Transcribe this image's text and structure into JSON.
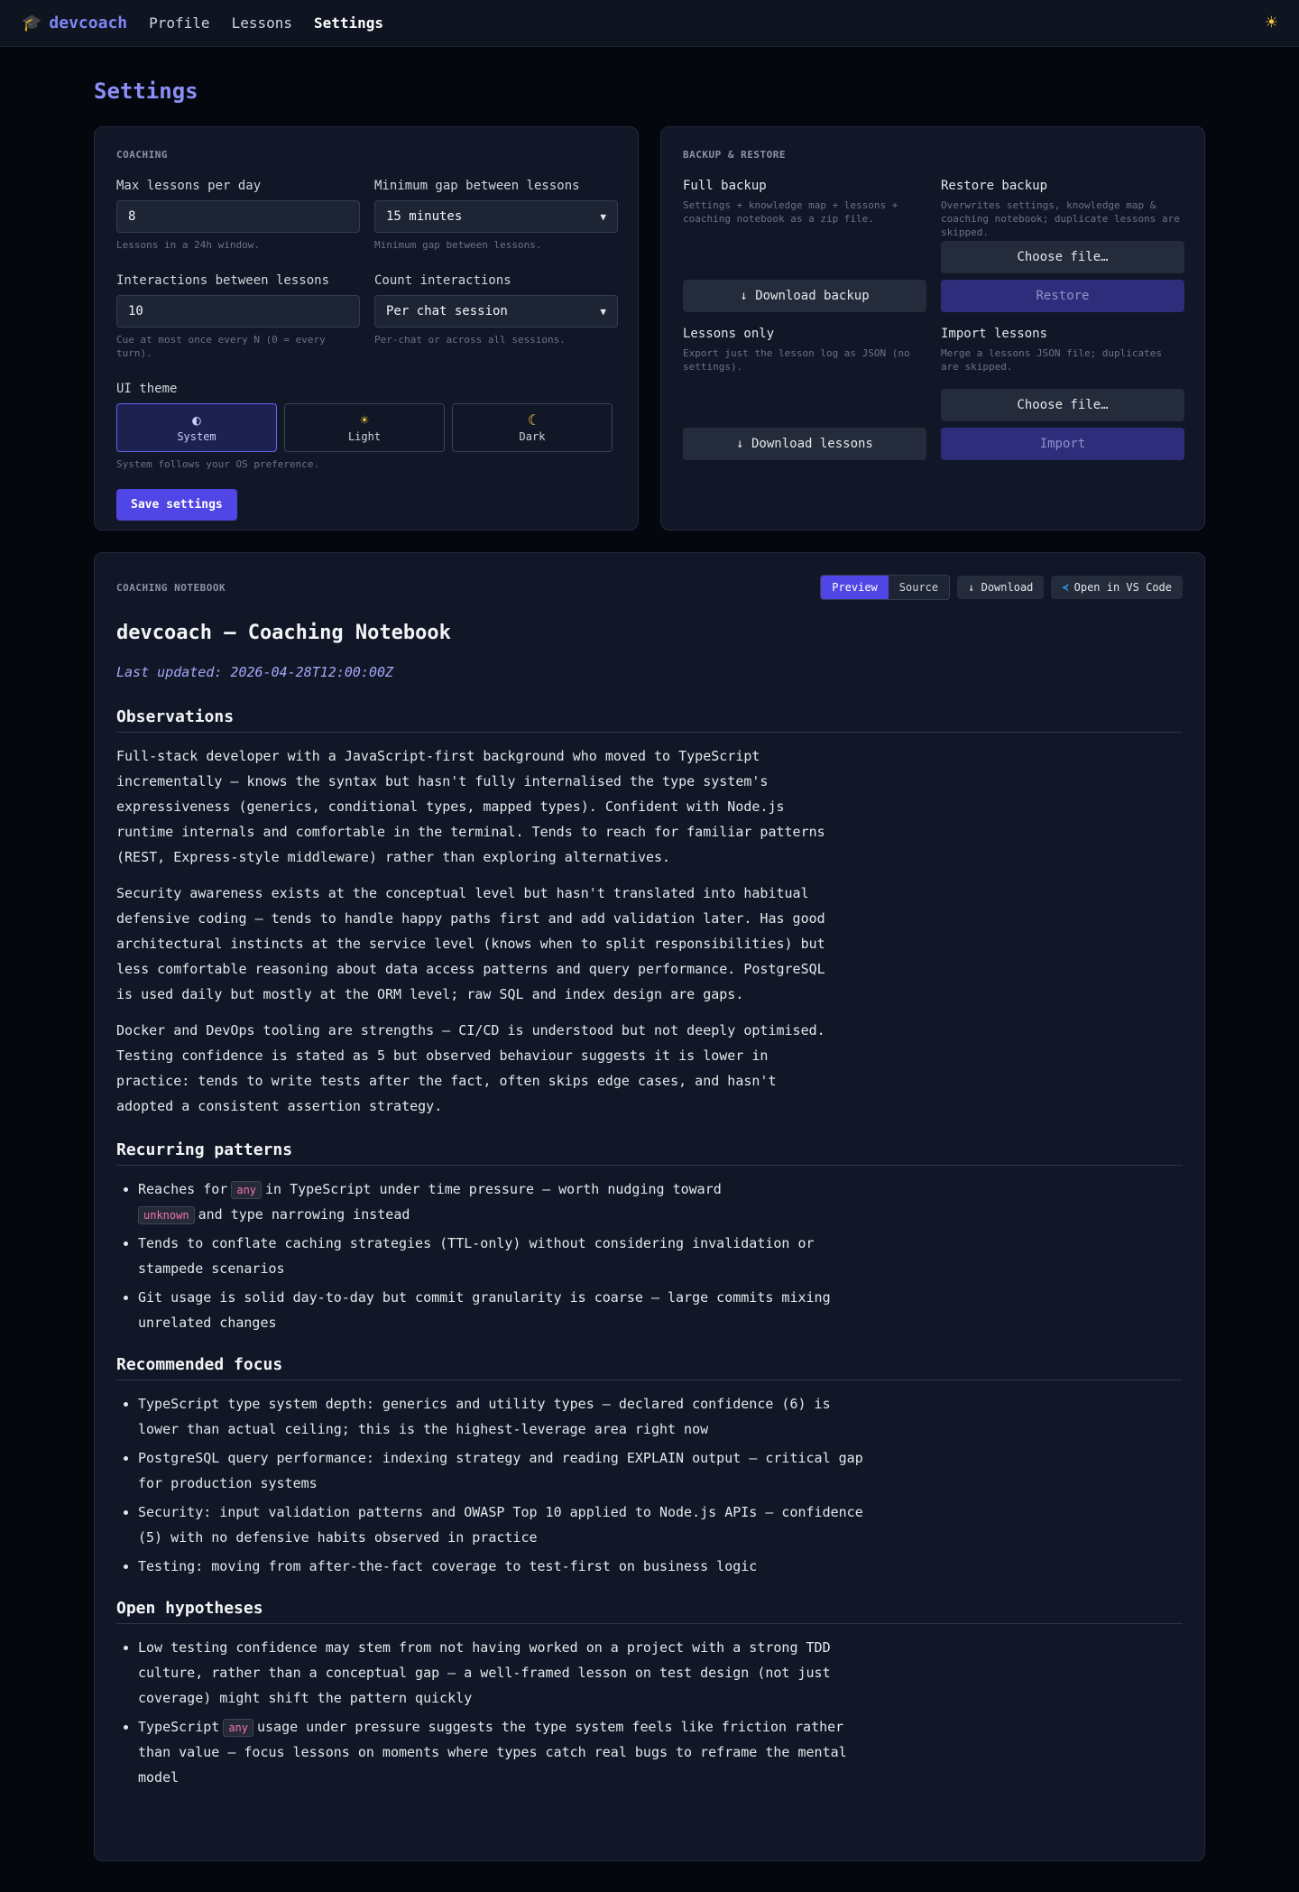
{
  "nav": {
    "brand": "devcoach",
    "links": [
      "Profile",
      "Lessons",
      "Settings"
    ],
    "active": "Settings"
  },
  "page": {
    "title": "Settings"
  },
  "coaching": {
    "section": "COACHING",
    "max_lessons_label": "Max lessons per day",
    "max_lessons_value": "8",
    "max_lessons_hint": "Lessons in a 24h window.",
    "min_gap_label": "Minimum gap between lessons",
    "min_gap_value": "15 minutes",
    "min_gap_hint": "Minimum gap between lessons.",
    "interactions_label": "Interactions between lessons",
    "interactions_value": "10",
    "interactions_hint": "Cue at most once every N (0 = every turn).",
    "count_label": "Count interactions",
    "count_value": "Per chat session",
    "count_hint": "Per-chat or across all sessions.",
    "theme_label": "UI theme",
    "themes": [
      {
        "label": "System",
        "icon": "half-moon-icon"
      },
      {
        "label": "Light",
        "icon": "sun-icon"
      },
      {
        "label": "Dark",
        "icon": "moon-icon"
      }
    ],
    "theme_selected": "System",
    "theme_hint": "System follows your OS preference.",
    "save_label": "Save settings"
  },
  "backup": {
    "section": "BACKUP & RESTORE",
    "full_title": "Full backup",
    "full_desc": "Settings + knowledge map + lessons + coaching notebook as a zip file.",
    "full_button": "↓ Download backup",
    "restore_title": "Restore backup",
    "restore_desc": "Overwrites settings, knowledge map & coaching notebook; duplicate lessons are skipped.",
    "restore_choose": "Choose file…",
    "restore_button": "Restore",
    "lessons_title": "Lessons only",
    "lessons_desc": "Export just the lesson log as JSON (no settings).",
    "lessons_button": "↓ Download lessons",
    "import_title": "Import lessons",
    "import_desc": "Merge a lessons JSON file; duplicates are skipped.",
    "import_choose": "Choose file…",
    "import_button": "Import"
  },
  "notebook": {
    "section": "COACHING NOTEBOOK",
    "tabs": [
      "Preview",
      "Source"
    ],
    "active_tab": "Preview",
    "download": "↓ Download",
    "open_vscode": "Open in VS Code",
    "title": "devcoach — Coaching Notebook",
    "updated": "Last updated: 2026-04-28T12:00:00Z",
    "observations_heading": "Observations",
    "observations": [
      "Full-stack developer with a JavaScript-first background who moved to TypeScript incrementally — knows the syntax but hasn't fully internalised the type system's expressiveness (generics, conditional types, mapped types). Confident with Node.js runtime internals and comfortable in the terminal. Tends to reach for familiar patterns (REST, Express-style middleware) rather than exploring alternatives.",
      "Security awareness exists at the conceptual level but hasn't translated into habitual defensive coding — tends to handle happy paths first and add validation later. Has good architectural instincts at the service level (knows when to split responsibilities) but less comfortable reasoning about data access patterns and query performance. PostgreSQL is used daily but mostly at the ORM level; raw SQL and index design are gaps.",
      "Docker and DevOps tooling are strengths — CI/CD is understood but not deeply optimised. Testing confidence is stated as 5 but observed behaviour suggests it is lower in practice: tends to write tests after the fact, often skips edge cases, and hasn't adopted a consistent assertion strategy."
    ],
    "patterns_heading": "Recurring patterns",
    "pattern1_a": "Reaches for",
    "pattern1_code1": "any",
    "pattern1_b": "in TypeScript under time pressure — worth nudging toward",
    "pattern1_code2": "unknown",
    "pattern1_c": "and type narrowing instead",
    "pattern2": "Tends to conflate caching strategies (TTL-only) without considering invalidation or stampede scenarios",
    "pattern3": "Git usage is solid day-to-day but commit granularity is coarse — large commits mixing unrelated changes",
    "focus_heading": "Recommended focus",
    "focus": [
      "TypeScript type system depth: generics and utility types — declared confidence (6) is lower than actual ceiling; this is the highest-leverage area right now",
      "PostgreSQL query performance: indexing strategy and reading EXPLAIN output — critical gap for production systems",
      "Security: input validation patterns and OWASP Top 10 applied to Node.js APIs — confidence (5) with no defensive habits observed in practice",
      "Testing: moving from after-the-fact coverage to test-first on business logic"
    ],
    "hypotheses_heading": "Open hypotheses",
    "hyp1": "Low testing confidence may stem from not having worked on a project with a strong TDD culture, rather than a conceptual gap — a well-framed lesson on test design (not just coverage) might shift the pattern quickly",
    "hyp2_a": "TypeScript",
    "hyp2_code": "any",
    "hyp2_b": "usage under pressure suggests the type system feels like friction rather than value — focus lessons on moments where types catch real bugs to reframe the mental model"
  }
}
